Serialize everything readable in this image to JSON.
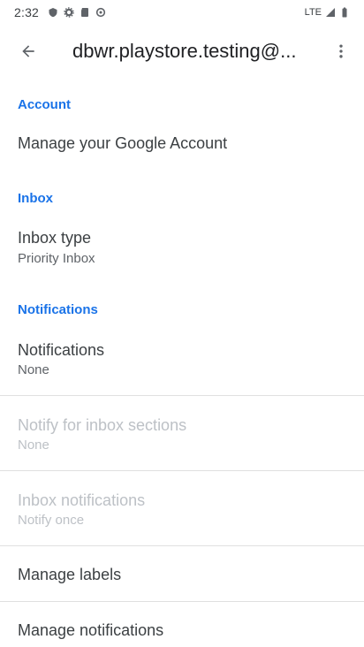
{
  "status_bar": {
    "time": "2:32",
    "network": "LTE"
  },
  "app_bar": {
    "title": "dbwr.playstore.testing@..."
  },
  "sections": {
    "account": {
      "header": "Account",
      "manage_account": "Manage your Google Account"
    },
    "inbox": {
      "header": "Inbox",
      "inbox_type_title": "Inbox type",
      "inbox_type_value": "Priority Inbox"
    },
    "notifications": {
      "header": "Notifications",
      "notifications_title": "Notifications",
      "notifications_value": "None",
      "notify_sections_title": "Notify for inbox sections",
      "notify_sections_value": "None",
      "inbox_notifications_title": "Inbox notifications",
      "inbox_notifications_value": "Notify once",
      "manage_labels": "Manage labels",
      "manage_notifications": "Manage notifications"
    }
  },
  "colors": {
    "accent": "#1a73e8",
    "text_primary": "#3c4043",
    "text_secondary": "#5f6368",
    "text_disabled": "#bdc1c6",
    "divider": "#e0e0e0"
  }
}
